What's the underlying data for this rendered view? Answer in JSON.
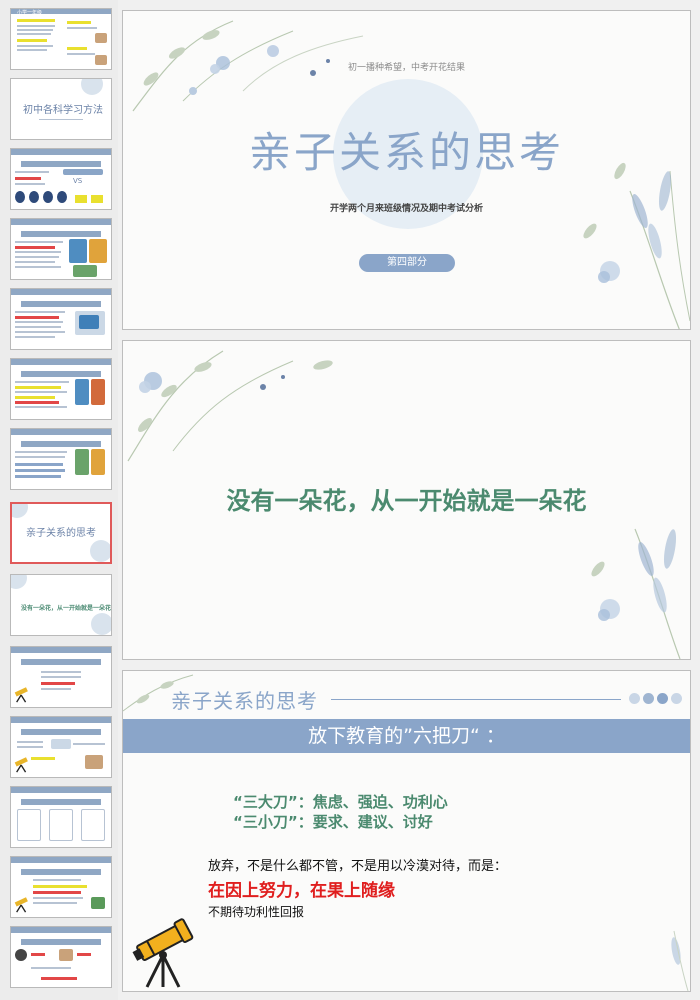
{
  "sidebar": {
    "thumbs": [
      {
        "label": "小学一年级",
        "type": "text"
      },
      {
        "label": "初中各科学习方法",
        "type": "title"
      },
      {
        "label": "初中各科学习方法",
        "type": "compare"
      },
      {
        "label": "初中各科学习方法",
        "type": "image"
      },
      {
        "label": "初中各科学习方法",
        "type": "image"
      },
      {
        "label": "初中各科学习方法",
        "type": "image"
      },
      {
        "label": "初中各科学习方法",
        "type": "image"
      },
      {
        "label": "亲子关系的思考",
        "type": "section-selected"
      },
      {
        "label": "没有一朵花，从一开始就是一朵花",
        "type": "quote"
      },
      {
        "label": "亲子关系的思考",
        "type": "scope"
      },
      {
        "label": "亲子关系的思考",
        "type": "scope"
      },
      {
        "label": "亲子关系的思考",
        "type": "boxes"
      },
      {
        "label": "亲子关系的思考",
        "type": "scope"
      },
      {
        "label": "亲子关系的思考",
        "type": "scope"
      }
    ]
  },
  "slide1": {
    "subtitle": "初一播种希望，中考开花结果",
    "title": "亲子关系的思考",
    "caption": "开学两个月来班级情况及期中考试分析",
    "button": "第四部分"
  },
  "slide2": {
    "quote": "没有一朵花，从一开始就是一朵花"
  },
  "slide3": {
    "heading": "亲子关系的思考",
    "band": "放下教育的”六把刀“  ：",
    "line1": "“三大刀”：焦虑、强迫、功利心",
    "line2": "“三小刀”：要求、建议、讨好",
    "line3": "放弃，不是什么都不管，不是用以冷漠对待，而是：",
    "line4": "在因上努力，在果上随缘",
    "line5": "不期待功利性回报",
    "dot_colors": [
      "#c9d6e6",
      "#9fb5d1",
      "#8aa5c9",
      "#c9d6e6"
    ]
  },
  "colors": {
    "accent_blue": "#8aa5c9",
    "accent_green": "#4b8a6f",
    "highlight_red": "#e01e1e"
  }
}
